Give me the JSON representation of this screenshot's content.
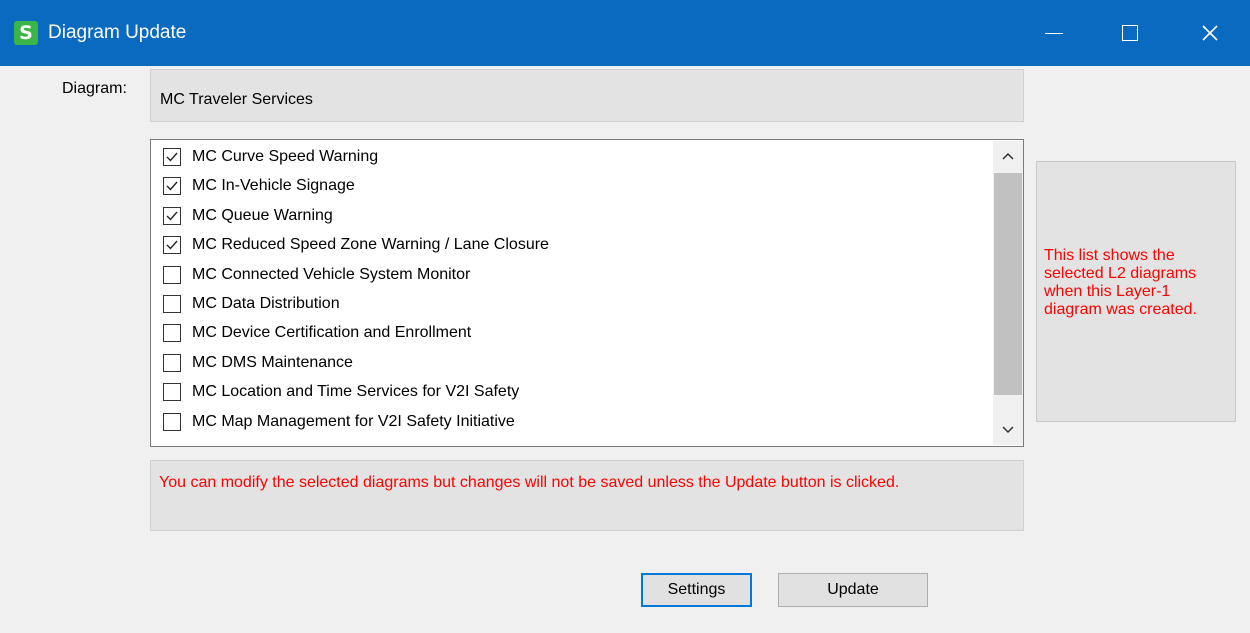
{
  "window": {
    "title": "Diagram Update",
    "app_icon_letter": "S",
    "accent_color": "#0a6abf"
  },
  "diagram": {
    "label": "Diagram:",
    "value": "MC Traveler Services"
  },
  "list": {
    "items": [
      {
        "label": "MC Curve Speed Warning",
        "checked": true
      },
      {
        "label": "MC In-Vehicle Signage",
        "checked": true
      },
      {
        "label": "MC Queue Warning",
        "checked": true
      },
      {
        "label": "MC Reduced Speed Zone Warning / Lane Closure",
        "checked": true
      },
      {
        "label": "MC Connected Vehicle System Monitor",
        "checked": false
      },
      {
        "label": "MC Data Distribution",
        "checked": false
      },
      {
        "label": "MC Device Certification and Enrollment",
        "checked": false
      },
      {
        "label": "MC DMS Maintenance",
        "checked": false
      },
      {
        "label": "MC Location and Time Services for V2I Safety",
        "checked": false
      },
      {
        "label": "MC Map Management for V2I Safety Initiative",
        "checked": false
      }
    ]
  },
  "note": {
    "text": "You can modify the selected diagrams but changes will not be saved unless the Update button is clicked.",
    "color": "#ff0000"
  },
  "side_panel": {
    "text": "This list shows the selected L2 diagrams when this Layer-1 diagram was created."
  },
  "buttons": {
    "settings_label": "Settings",
    "update_label": "Update"
  }
}
